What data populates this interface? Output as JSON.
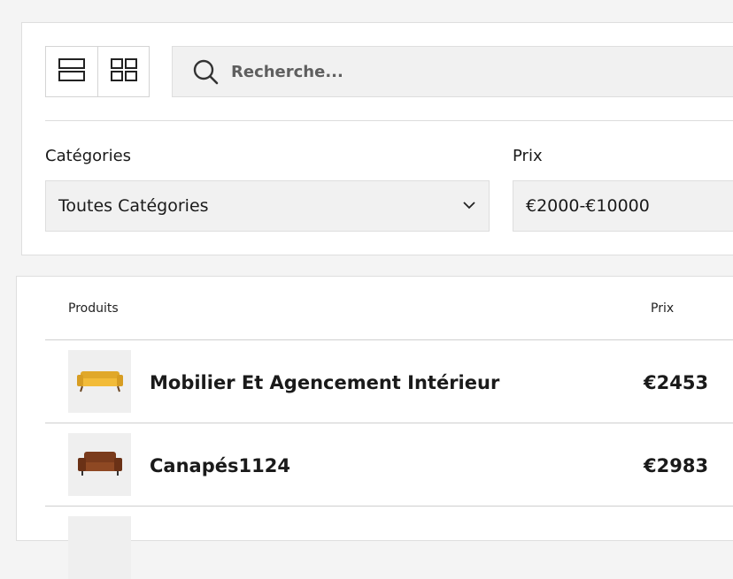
{
  "search": {
    "placeholder": "Recherche..."
  },
  "filters": {
    "categories_label": "Catégories",
    "categories_value": "Toutes Catégories",
    "price_label": "Prix",
    "price_value": "€2000-€10000"
  },
  "table": {
    "headers": {
      "product": "Produits",
      "price": "Prix"
    },
    "rows": [
      {
        "name": "Mobilier Et Agencement Intérieur",
        "price": "€2453",
        "thumb_icon": "yellow-sofa-icon"
      },
      {
        "name": "Canapés1124",
        "price": "€2983",
        "thumb_icon": "brown-leather-sofa-icon"
      }
    ]
  },
  "colors": {
    "background": "#f4f4f4",
    "card": "#ffffff",
    "input": "#f1f1f1"
  }
}
